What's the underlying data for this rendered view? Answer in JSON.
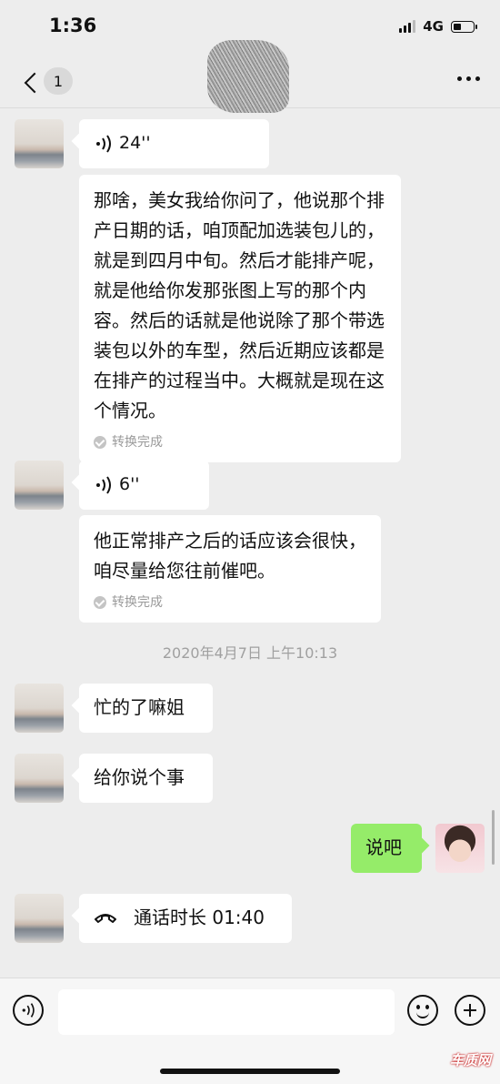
{
  "status_bar": {
    "time": "1:36",
    "network": "4G",
    "signal_bars_filled": 3,
    "signal_bars_total": 4,
    "battery_level": 0.4
  },
  "nav": {
    "unread_count": "1"
  },
  "messages": {
    "voice1_duration": "24''",
    "transcript1_text": "那啥，美女我给你问了，他说那个排产日期的话，咱顶配加选装包儿的，就是到四月中旬。然后才能排产呢，就是他给你发那张图上写的那个内容。然后的话就是他说除了那个带选装包以外的车型，然后近期应该都是在排产的过程当中。大概就是现在这个情况。",
    "transcript1_status": "转换完成",
    "voice2_duration": "6''",
    "transcript2_text": "他正常排产之后的话应该会很快，咱尽量给您往前催吧。",
    "transcript2_status": "转换完成",
    "timestamp": "2020年4月7日 上午10:13",
    "text1": "忙的了嘛姐",
    "text2": "给你说个事",
    "self_text": "说吧",
    "call_text": "通话时长 01:40"
  },
  "watermark": "车质网"
}
